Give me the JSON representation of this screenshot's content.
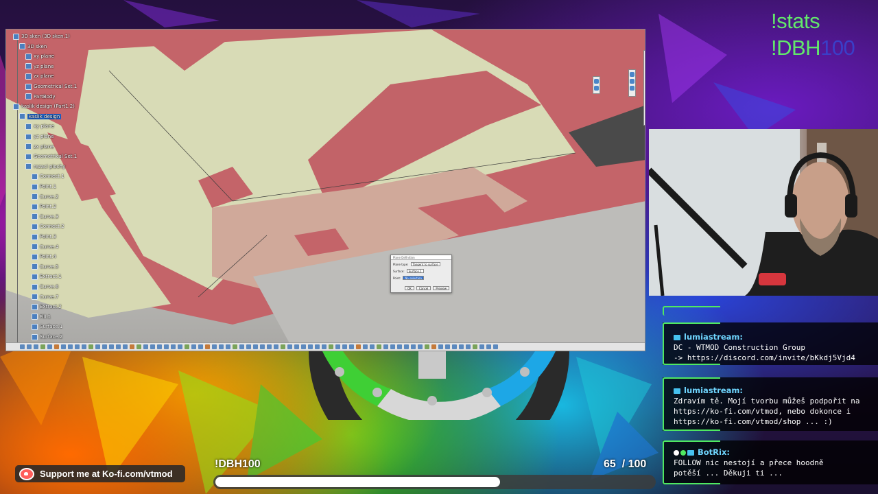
{
  "overlay": {
    "commands": {
      "stats": "!stats",
      "dbh_prefix": "!DBH",
      "dbh_suffix": "100"
    },
    "kofi": {
      "text": "Support me at Ko-fi.com/vtmod",
      "icon": "kofi-cup-icon"
    },
    "goal": {
      "title": "!DBH100",
      "current": 65,
      "target": 100,
      "count_text": "65  / 100",
      "fill_fraction": 0.65
    },
    "colors": {
      "accent_green": "#4fe861",
      "command_green": "#62e86b",
      "chat_name": "#6fd6ff",
      "kofi_red": "#ff5e5b"
    }
  },
  "chat": {
    "messages": [
      {
        "user": "lumiastream:",
        "badges": [
          "bot-icon"
        ],
        "lines": [
          "DC - WTMOD Construction Group",
          "-> https://discord.com/invite/bKkdj5Vjd4"
        ]
      },
      {
        "user": "lumiastream:",
        "badges": [
          "bot-icon"
        ],
        "lines": [
          "Zdravím tě. Mojí tvorbu můžeš podpořit na",
          "https://ko-fi.com/vtmod, nebo dokonce i",
          "https://ko-fi.com/vtmod/shop ... :)"
        ]
      },
      {
        "user": "BotRix:",
        "badges": [
          "dot-icon",
          "check-icon",
          "twitch-icon"
        ],
        "lines": [
          "FOLLOW nic nestojí a přece hoodně",
          "potěší ... Děkuji ti ..."
        ]
      }
    ]
  },
  "cad": {
    "tree": [
      {
        "label": "3D sken (3D sken.1)",
        "indent": 0
      },
      {
        "label": "3D sken",
        "indent": 1
      },
      {
        "label": "xy plane",
        "indent": 2
      },
      {
        "label": "yz plane",
        "indent": 2
      },
      {
        "label": "zx plane",
        "indent": 2
      },
      {
        "label": "Geometrical Set.1",
        "indent": 2
      },
      {
        "label": "PartBody",
        "indent": 2
      },
      {
        "label": "kaslik design (Part1.2)",
        "indent": 0
      },
      {
        "label": "kaslik design",
        "indent": 1,
        "selected": true
      },
      {
        "label": "xy plane",
        "indent": 2
      },
      {
        "label": "yz plane",
        "indent": 2
      },
      {
        "label": "zx plane",
        "indent": 2
      },
      {
        "label": "Geometrical Set.1",
        "indent": 2
      },
      {
        "label": "rezaci plochy",
        "indent": 2
      },
      {
        "label": "Connect.1",
        "indent": 3
      },
      {
        "label": "Point.1",
        "indent": 3
      },
      {
        "label": "Curve.2",
        "indent": 3
      },
      {
        "label": "Point.2",
        "indent": 3
      },
      {
        "label": "Curve.3",
        "indent": 3
      },
      {
        "label": "Connect.2",
        "indent": 3
      },
      {
        "label": "Point.3",
        "indent": 3
      },
      {
        "label": "Curve.4",
        "indent": 3
      },
      {
        "label": "Point.4",
        "indent": 3
      },
      {
        "label": "Curve.5",
        "indent": 3
      },
      {
        "label": "Extract.1",
        "indent": 3
      },
      {
        "label": "Curve.6",
        "indent": 3
      },
      {
        "label": "Curve.7",
        "indent": 3
      },
      {
        "label": "Extract.2",
        "indent": 3
      },
      {
        "label": "Fill.1",
        "indent": 3
      },
      {
        "label": "Surface.1",
        "indent": 3
      },
      {
        "label": "Surface.2",
        "indent": 3
      }
    ],
    "dialog": {
      "title": "Plane Definition",
      "type_label": "Plane type:",
      "type_value": "Tangent to surface",
      "surface_label": "Surface:",
      "surface_value": "Surface.1",
      "point_label": "Point:",
      "point_value": "No selection",
      "ok_label": "OK",
      "cancel_label": "Cancel",
      "preview_label": "Preview"
    },
    "colors": {
      "deviation_red": "#c96a6e",
      "surface_beige": "#d8dbb6",
      "background": "#cfcecb"
    }
  }
}
